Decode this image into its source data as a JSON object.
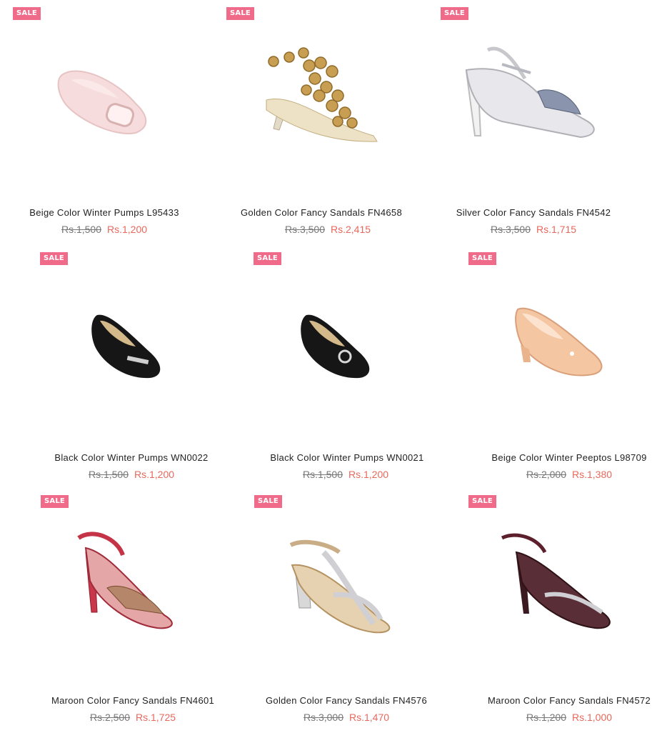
{
  "badge_label": "SALE",
  "colors": {
    "badge": "#f06a8a",
    "sale_price": "#e8685c",
    "old_price": "#777777",
    "title": "#1f1f1f"
  },
  "products": [
    {
      "title": "Beige Color Winter Pumps L95433",
      "old_price": "Rs.1,500",
      "price": "Rs.1,200",
      "image": "beige-pump"
    },
    {
      "title": "Golden Color Fancy Sandals FN4658",
      "old_price": "Rs.3,500",
      "price": "Rs.2,415",
      "image": "golden-jeweled-sandal"
    },
    {
      "title": "Silver Color Fancy Sandals FN4542",
      "old_price": "Rs.3,500",
      "price": "Rs.1,715",
      "image": "silver-sandal"
    },
    {
      "title": "Black Color Winter Pumps WN0022",
      "old_price": "Rs.1,500",
      "price": "Rs.1,200",
      "image": "black-pump"
    },
    {
      "title": "Black Color Winter Pumps WN0021",
      "old_price": "Rs.1,500",
      "price": "Rs.1,200",
      "image": "black-pump-bow"
    },
    {
      "title": "Beige Color Winter Peeptos L98709",
      "old_price": "Rs.2,000",
      "price": "Rs.1,380",
      "image": "beige-peeptoe"
    },
    {
      "title": "Maroon Color Fancy Sandals FN4601",
      "old_price": "Rs.2,500",
      "price": "Rs.1,725",
      "image": "red-metallic-sandal"
    },
    {
      "title": "Golden Color Fancy Sandals FN4576",
      "old_price": "Rs.3,000",
      "price": "Rs.1,470",
      "image": "golden-tstrap-sandal"
    },
    {
      "title": "Maroon Color Fancy Sandals FN4572",
      "old_price": "Rs.1,200",
      "price": "Rs.1,000",
      "image": "maroon-sandal"
    }
  ]
}
